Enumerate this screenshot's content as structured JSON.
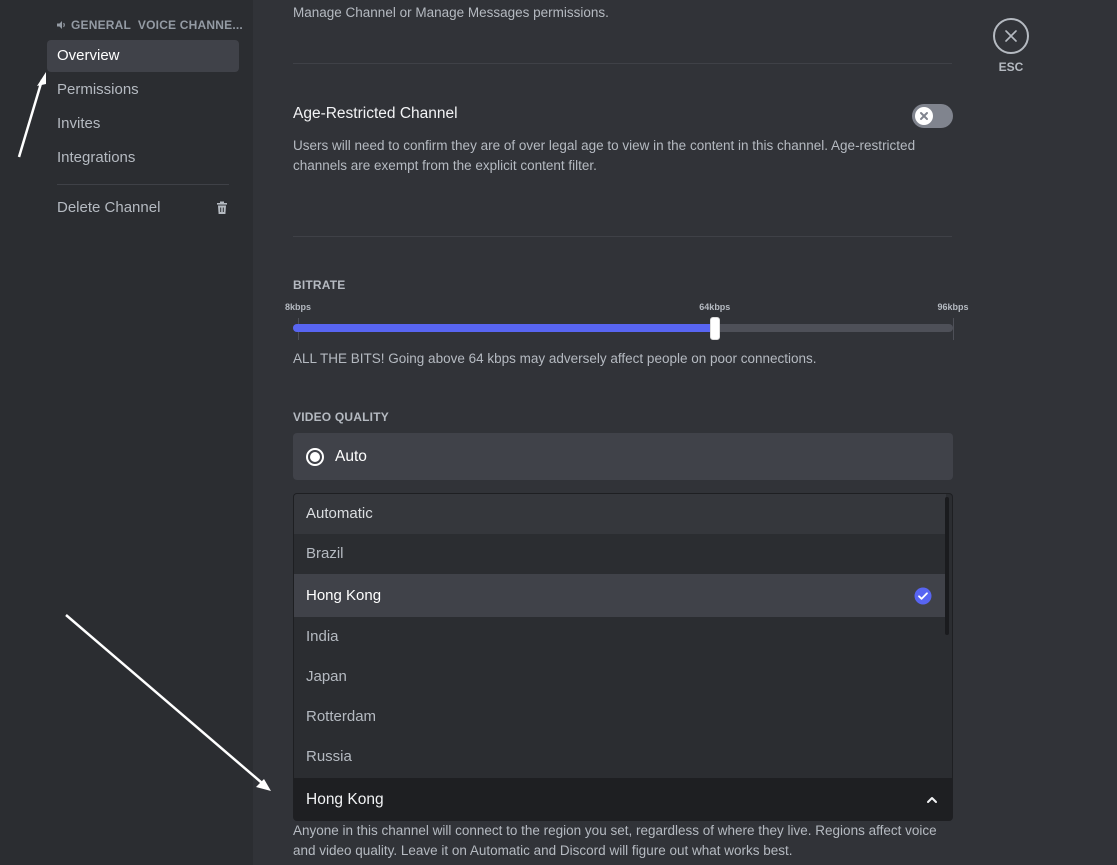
{
  "sidebar": {
    "header": "GENERAL  VOICE CHANNE...",
    "header_icon": "speaker-icon",
    "items": [
      {
        "label": "Overview",
        "selected": true
      },
      {
        "label": "Permissions",
        "selected": false
      },
      {
        "label": "Invites",
        "selected": false
      },
      {
        "label": "Integrations",
        "selected": false
      }
    ],
    "delete_label": "Delete Channel",
    "delete_icon": "trash-icon"
  },
  "main": {
    "permissions_note": "Manage Channel or Manage Messages permissions.",
    "age_restricted": {
      "title": "Age-Restricted Channel",
      "description": "Users will need to confirm they are of over legal age to view in the content in this channel. Age-restricted channels are exempt from the explicit content filter.",
      "enabled": false
    },
    "bitrate": {
      "label": "BITRATE",
      "min_label": "8kbps",
      "current_label": "64kbps",
      "max_label": "96kbps",
      "min": 8,
      "max": 96,
      "value": 64,
      "description": "ALL THE BITS! Going above 64 kbps may adversely affect people on poor connections."
    },
    "video_quality": {
      "label": "VIDEO QUALITY",
      "selected_option": "Auto"
    },
    "region": {
      "options": [
        {
          "label": "Automatic",
          "state": "hover"
        },
        {
          "label": "Brazil",
          "state": "normal"
        },
        {
          "label": "Hong Kong",
          "state": "selected"
        },
        {
          "label": "India",
          "state": "normal"
        },
        {
          "label": "Japan",
          "state": "normal"
        },
        {
          "label": "Rotterdam",
          "state": "normal"
        },
        {
          "label": "Russia",
          "state": "normal"
        }
      ],
      "current_value": "Hong Kong",
      "description": "Anyone in this channel will connect to the region you set, regardless of where they live. Regions affect voice and video quality. Leave it on Automatic and Discord will figure out what works best."
    },
    "close": {
      "label": "ESC",
      "icon": "close-icon"
    }
  },
  "colors": {
    "accent": "#5865f2",
    "sidebar_bg": "#2b2d31",
    "main_bg": "#313338",
    "selected_bg": "#404249"
  }
}
